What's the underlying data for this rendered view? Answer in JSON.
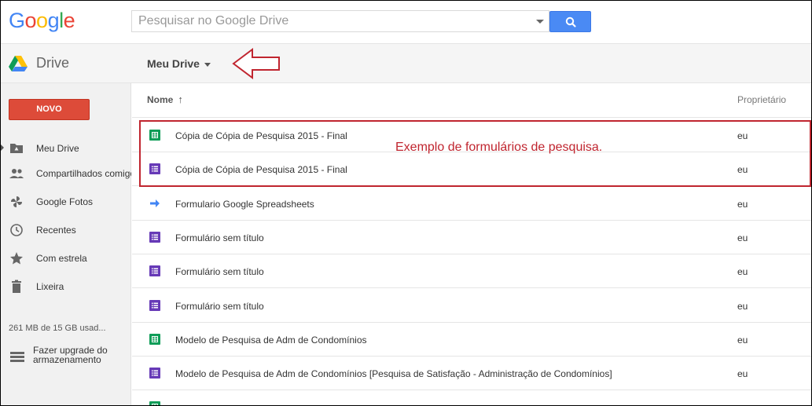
{
  "logo": {
    "text": "Google",
    "letters": [
      {
        "ch": "G",
        "color": "#4285f4"
      },
      {
        "ch": "o",
        "color": "#ea4335"
      },
      {
        "ch": "o",
        "color": "#fbbc05"
      },
      {
        "ch": "g",
        "color": "#4285f4"
      },
      {
        "ch": "l",
        "color": "#34a853"
      },
      {
        "ch": "e",
        "color": "#ea4335"
      }
    ]
  },
  "search": {
    "placeholder": "Pesquisar no Google Drive",
    "value": ""
  },
  "app": {
    "title": "Drive",
    "breadcrumb": "Meu Drive"
  },
  "sidebar": {
    "new_button": "NOVO",
    "items": [
      {
        "label": "Meu Drive",
        "icon": "folder-drive-icon",
        "selected": true
      },
      {
        "label": "Compartilhados comigo",
        "icon": "people-icon",
        "selected": false
      },
      {
        "label": "Google Fotos",
        "icon": "pinwheel-icon",
        "selected": false
      },
      {
        "label": "Recentes",
        "icon": "clock-icon",
        "selected": false
      },
      {
        "label": "Com estrela",
        "icon": "star-icon",
        "selected": false
      },
      {
        "label": "Lixeira",
        "icon": "trash-icon",
        "selected": false
      }
    ],
    "storage": "261 MB de 15 GB usad...",
    "upgrade_line1": "Fazer upgrade do",
    "upgrade_line2": "armazenamento"
  },
  "list": {
    "col_name": "Nome",
    "col_owner": "Proprietário",
    "rows": [
      {
        "name": "Cópia de Cópia de Pesquisa 2015 - Final",
        "owner": "eu",
        "type": "sheet"
      },
      {
        "name": "Cópia de Cópia de Pesquisa 2015 - Final",
        "owner": "eu",
        "type": "form"
      },
      {
        "name": "Formulario Google Spreadsheets",
        "owner": "eu",
        "type": "shortcut"
      },
      {
        "name": "Formulário sem título",
        "owner": "eu",
        "type": "form"
      },
      {
        "name": "Formulário sem título",
        "owner": "eu",
        "type": "form"
      },
      {
        "name": "Formulário sem título",
        "owner": "eu",
        "type": "form"
      },
      {
        "name": "Modelo de Pesquisa de Adm de Condomínios",
        "owner": "eu",
        "type": "sheet"
      },
      {
        "name": "Modelo de Pesquisa de Adm de Condomínios [Pesquisa de Satisfação - Administração de Condomínios]",
        "owner": "eu",
        "type": "form"
      },
      {
        "name": "",
        "owner": "",
        "type": "sheet"
      }
    ]
  },
  "annotation": {
    "text": "Exemplo de formulários de pesquisa.",
    "color": "#c0252f"
  },
  "colors": {
    "novo": "#dd4b39",
    "search_button": "#4a8af4",
    "sheet": "#0f9d58",
    "form": "#673ab7",
    "shortcut": "#4285f4"
  }
}
